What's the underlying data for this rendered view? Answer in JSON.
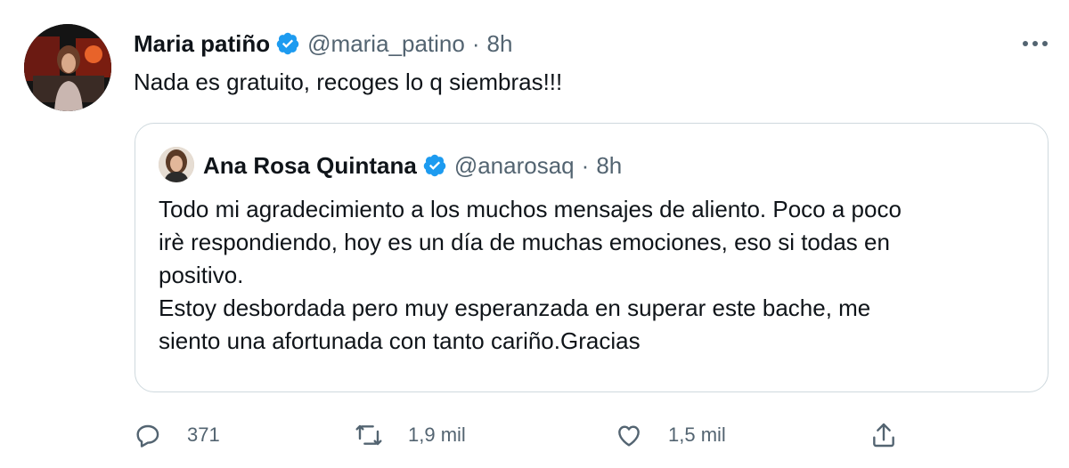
{
  "tweet": {
    "author_name": "Maria patiño",
    "author_handle": "@maria_patino",
    "separator": "·",
    "time": "8h",
    "text": "Nada es gratuito, recoges lo q siembras!!!",
    "more_icon": "more-horizontal-icon"
  },
  "quoted": {
    "author_name": "Ana Rosa Quintana",
    "author_handle": "@anarosaq",
    "separator": "·",
    "time": "8h",
    "lines": [
      "Todo mi agradecimiento a los muchos mensajes de aliento. Poco a poco",
      "irè respondiendo, hoy es un día de muchas emociones, eso si todas en",
      "positivo.",
      "Estoy desbordada pero muy esperanzada en superar este bache, me",
      "siento una afortunada con tanto cariño.Gracias"
    ]
  },
  "actions": {
    "replies": "371",
    "retweets": "1,9 mil",
    "likes": "1,5 mil"
  },
  "colors": {
    "verified": "#1d9bf0",
    "muted": "#536471",
    "text": "#0f1419",
    "border": "#cfd9de"
  }
}
